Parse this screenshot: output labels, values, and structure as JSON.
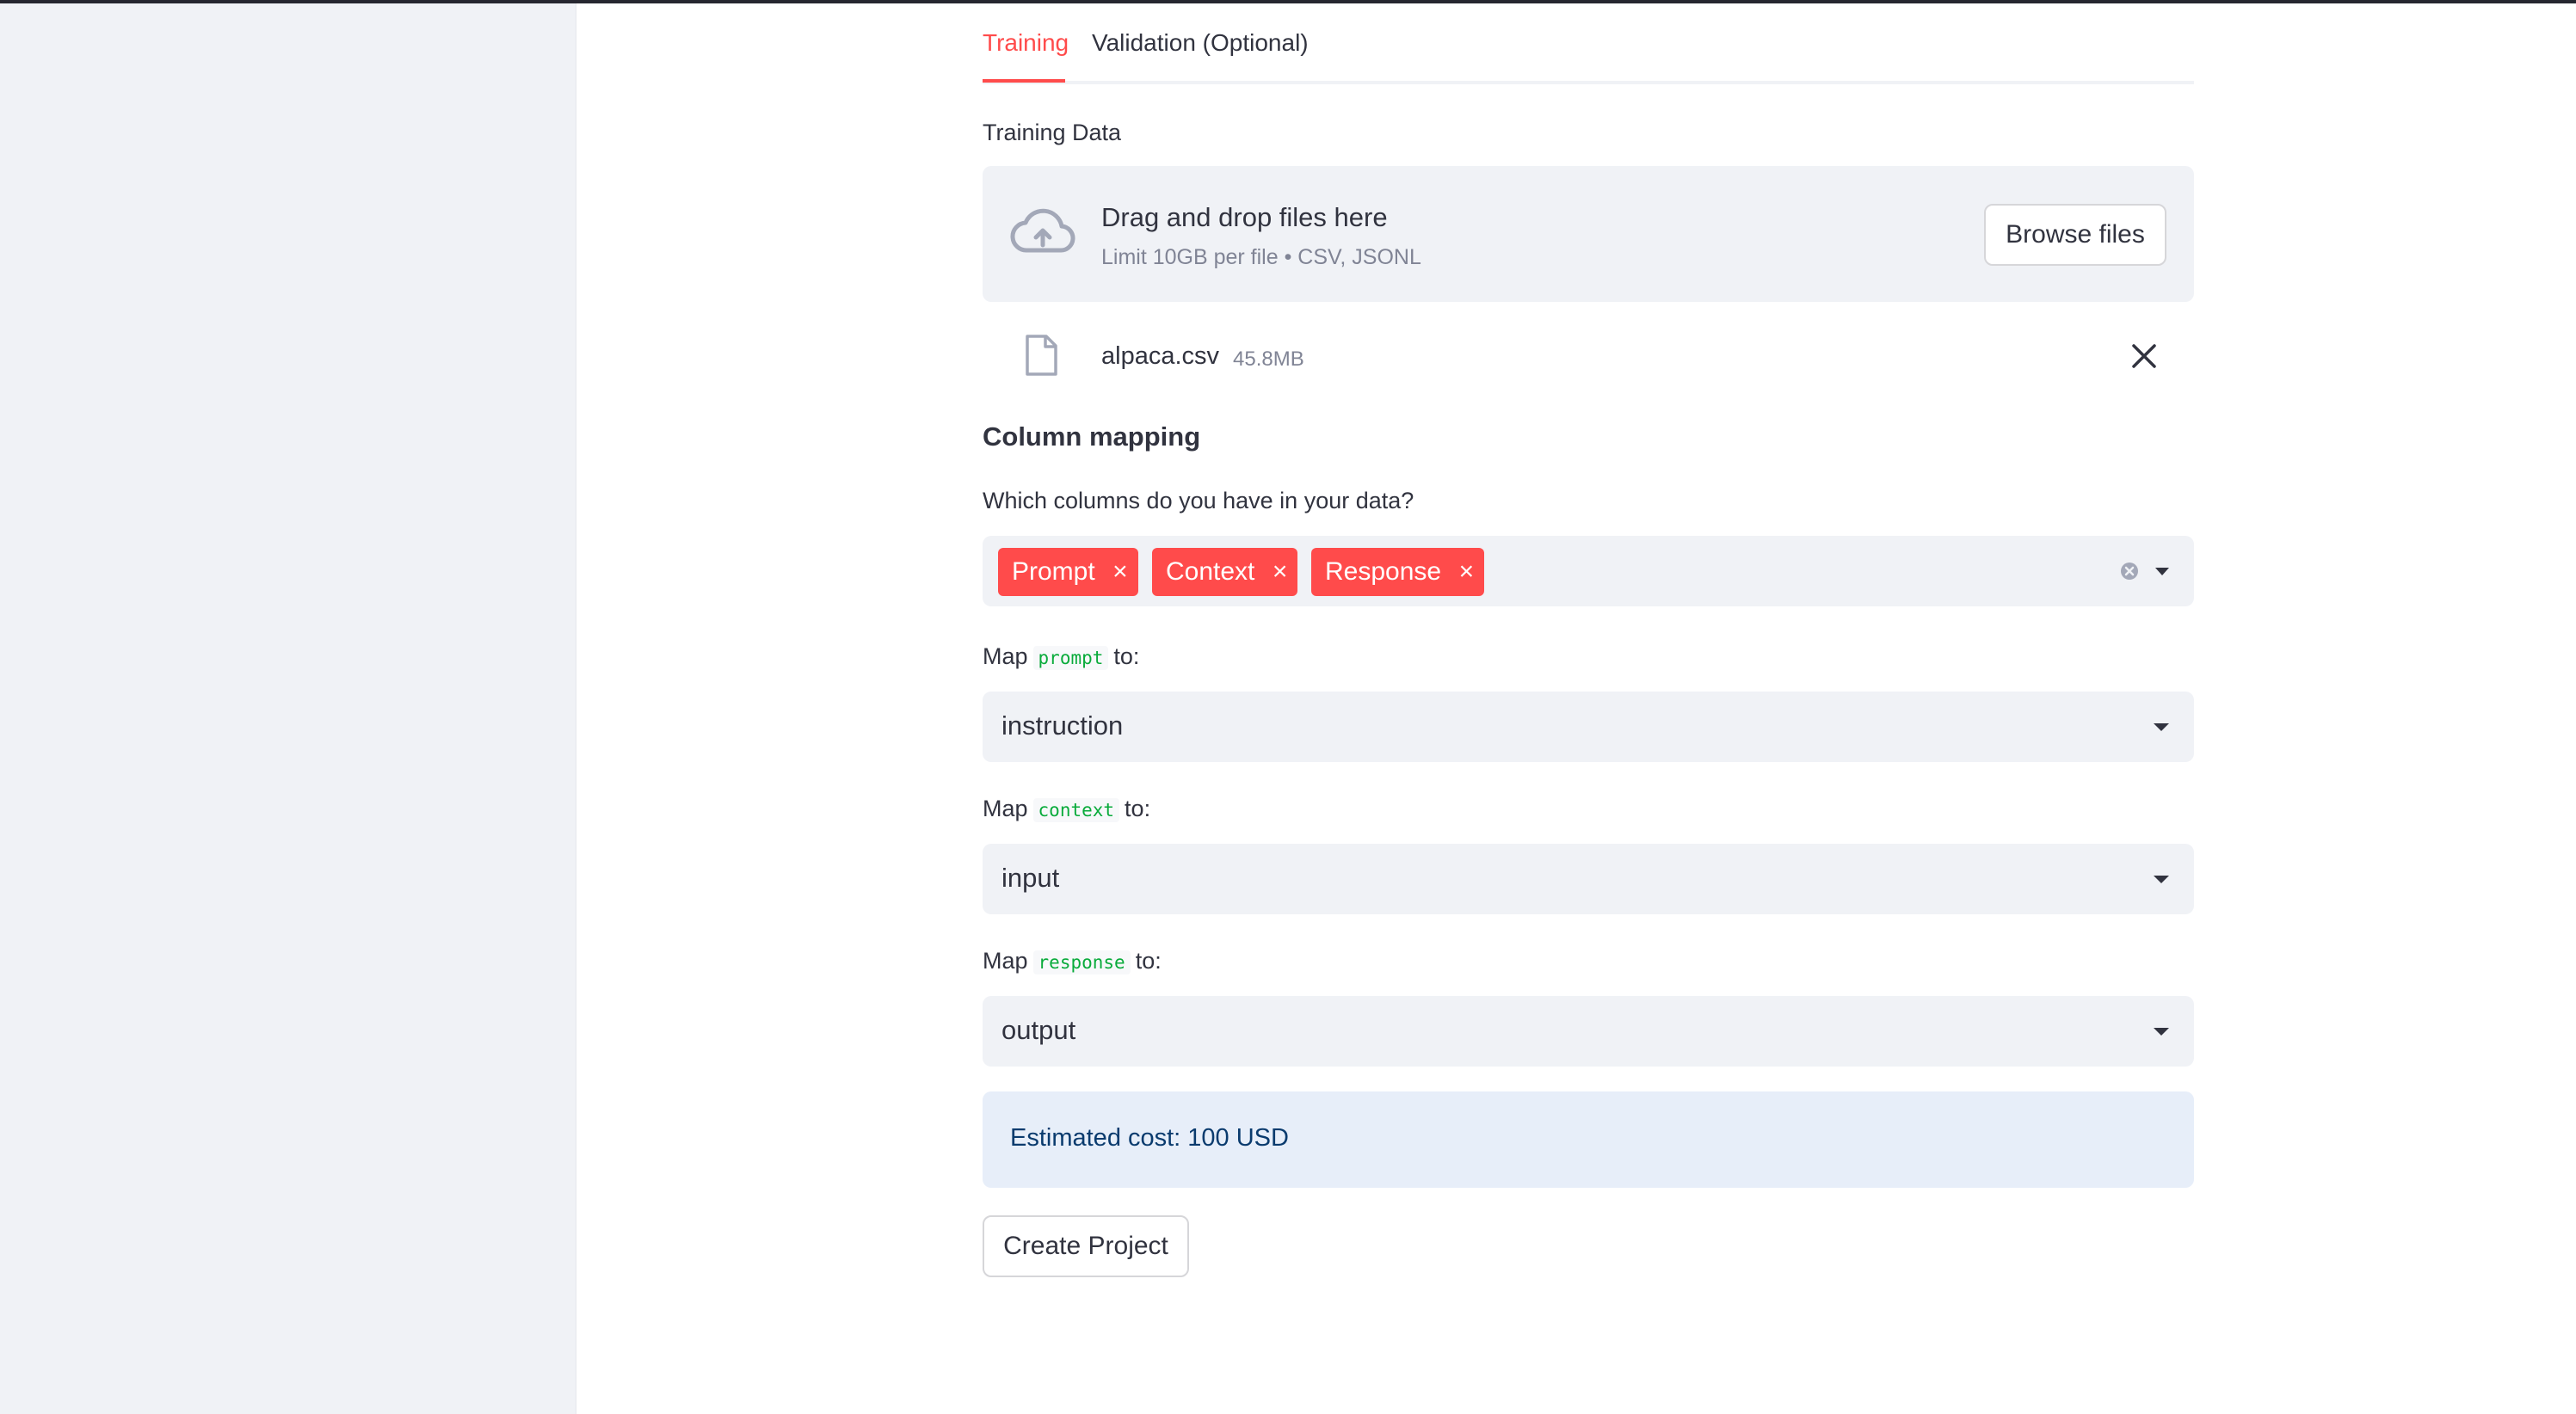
{
  "tabs": [
    {
      "label": "Training",
      "active": true
    },
    {
      "label": "Validation (Optional)",
      "active": false
    }
  ],
  "training_data": {
    "label": "Training Data",
    "uploader": {
      "title": "Drag and drop files here",
      "subtitle": "Limit 10GB per file • CSV, JSONL",
      "browse_label": "Browse files",
      "icon": "cloud-upload-icon"
    },
    "file": {
      "name": "alpaca.csv",
      "size": "45.8MB",
      "icon": "file-icon",
      "remove_icon": "close-icon"
    }
  },
  "column_mapping": {
    "title": "Column mapping",
    "question": "Which columns do you have in your data?",
    "selected": [
      "Prompt",
      "Context",
      "Response"
    ],
    "chip_remove": "×",
    "mappings": [
      {
        "prefix": "Map",
        "key": "prompt",
        "suffix": "to:",
        "value": "instruction"
      },
      {
        "prefix": "Map",
        "key": "context",
        "suffix": "to:",
        "value": "input"
      },
      {
        "prefix": "Map",
        "key": "response",
        "suffix": "to:",
        "value": "output"
      }
    ]
  },
  "estimate": {
    "text": "Estimated cost: 100 USD"
  },
  "create_label": "Create Project",
  "colors": {
    "accent": "#ff4b4b",
    "info_bg": "#e7eef9",
    "info_text": "#0a3b6e",
    "widget_bg": "#f0f2f6"
  }
}
